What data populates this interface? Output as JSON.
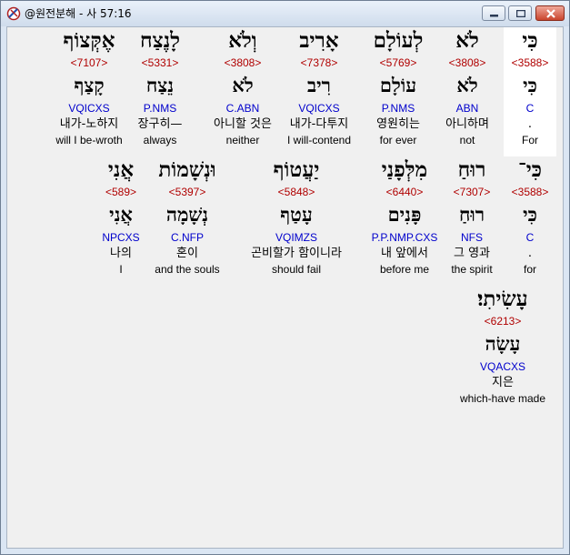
{
  "window": {
    "title": "@원전분해 - 사 57:16"
  },
  "colors": {
    "strongs": "#b00000",
    "morph": "#0000cc",
    "highlight": "#ffffff"
  },
  "rows": [
    [
      {
        "heb": "כִּי",
        "strong": "<3588>",
        "lemma": "כִּי",
        "morph": "C",
        "kor": ".",
        "eng": "For",
        "highlight": true
      },
      {
        "heb": "לֹא",
        "strong": "<3808>",
        "lemma": "לֹא",
        "morph": "ABN",
        "kor": "아니하며",
        "eng": "not"
      },
      {
        "heb": "לְעוֹלָם",
        "strong": "<5769>",
        "lemma": "עוֹלָם",
        "morph": "P.NMS",
        "kor": "영원히는",
        "eng": "for ever"
      },
      {
        "heb": "אָרִיב",
        "strong": "<7378>",
        "lemma": "רִיב",
        "morph": "VQICXS",
        "kor": "내가-다투지",
        "eng": "I will-contend"
      },
      {
        "heb": "וְלֹא",
        "strong": "<3808>",
        "lemma": "לֹא",
        "morph": "C.ABN",
        "kor": "아니할 것은",
        "eng": "neither"
      },
      {
        "heb": "לָנֶצַח",
        "strong": "<5331>",
        "lemma": "נֵצַח",
        "morph": "P.NMS",
        "kor": "장구히—",
        "eng": "always"
      },
      {
        "heb": "אֶקְּצוֹף",
        "strong": "<7107>",
        "lemma": "קָצַף",
        "morph": "VQICXS",
        "kor": "내가-노하지",
        "eng": "will I be-wroth"
      }
    ],
    [
      {
        "heb": "כִּי־",
        "strong": "<3588>",
        "lemma": "כִּי",
        "morph": "C",
        "kor": ".",
        "eng": "for"
      },
      {
        "heb": "רוּחַ",
        "strong": "<7307>",
        "lemma": "רוּחַ",
        "morph": "NFS",
        "kor": "그 영과",
        "eng": "the spirit"
      },
      {
        "heb": "מִלְּפָנַי",
        "strong": "<6440>",
        "lemma": "פָּנִים",
        "morph": "P.P.NMP.CXS",
        "kor": "내 앞에서",
        "eng": "before me"
      },
      {
        "heb": "יַעֲטוֹף",
        "strong": "<5848>",
        "lemma": "עָטַף",
        "morph": "VQIMZS",
        "kor": "곤비할가 함이니라",
        "eng": "should fail"
      },
      {
        "heb": "וּנְשָׁמוֹת",
        "strong": "<5397>",
        "lemma": "נְשָׁמָה",
        "morph": "C.NFP",
        "kor": "혼이",
        "eng": "and the souls"
      },
      {
        "heb": "אֲנִי",
        "strong": "<589>",
        "lemma": "אֲנִי",
        "morph": "NPCXS",
        "kor": "나의",
        "eng": "I"
      }
    ],
    [
      {
        "heb": "עָשִׂיתִי׃",
        "strong": "<6213>",
        "lemma": "עָשָׂה",
        "morph": "VQACXS",
        "kor": "지은",
        "eng": "which-have made"
      }
    ]
  ]
}
